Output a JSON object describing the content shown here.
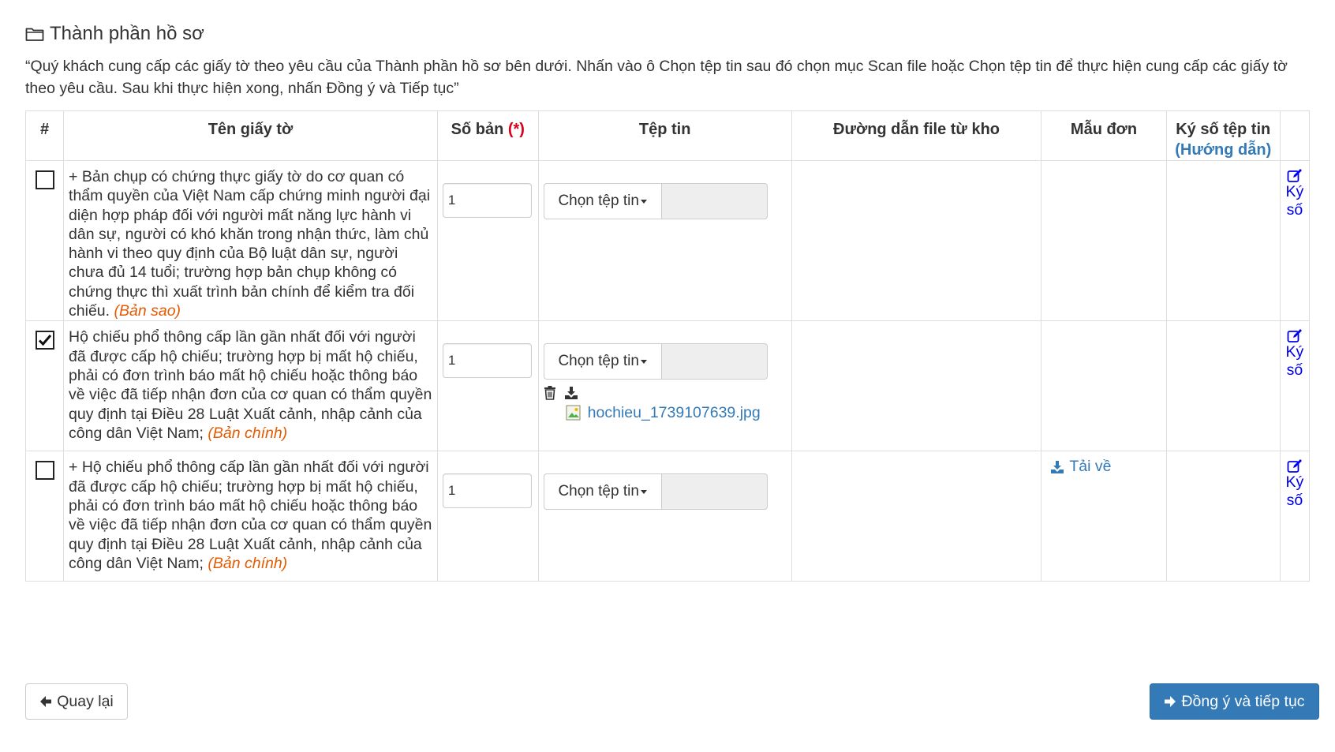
{
  "section": {
    "title": "Thành phần hồ sơ",
    "icon": "folder-open-icon",
    "instructions": "“Quý khách cung cấp các giấy tờ theo yêu cầu của Thành phần hồ sơ bên dưới. Nhấn vào ô Chọn tệp tin sau đó chọn mục Scan file hoặc Chọn tệp tin để thực hiện cung cấp các giấy tờ theo yêu cầu. Sau khi thực hiện xong, nhấn Đồng ý và Tiếp tục”"
  },
  "table": {
    "headers": {
      "index": "#",
      "name": "Tên giấy tờ",
      "copies": "Số bản",
      "copies_required": "(*)",
      "file": "Tệp tin",
      "repo_path": "Đường dẫn file từ kho",
      "template": "Mẫu đơn",
      "sign_file": "Ký số tệp tin",
      "sign_guide": "(Hướng dẫn)"
    },
    "choose_file_label": "Chọn tệp tin",
    "sign_label": "Ký số",
    "rows": [
      {
        "checked": false,
        "name": "+ Bản chụp có chứng thực giấy tờ do cơ quan có thẩm quyền của Việt Nam cấp chứng minh người đại diện hợp pháp đối với người mất năng lực hành vi dân sự, người có khó khăn trong nhận thức, làm chủ hành vi theo quy định của Bộ luật dân sự, người chưa đủ 14 tuổi; trường hợp bản chụp không có chứng thực thì xuất trình bản chính để kiểm tra đối chiếu.",
        "doc_type": "(Bản sao)",
        "copies": "1",
        "uploaded_file": "",
        "template_link": ""
      },
      {
        "checked": true,
        "name": "Hộ chiếu phổ thông cấp lần gần nhất đối với người đã được cấp hộ chiếu; trường hợp bị mất hộ chiếu, phải có đơn trình báo mất hộ chiếu hoặc thông báo về việc đã tiếp nhận đơn của cơ quan có thẩm quyền quy định tại Điều 28 Luật Xuất cảnh, nhập cảnh của công dân Việt Nam;",
        "doc_type": "(Bản chính)",
        "copies": "1",
        "uploaded_file": "hochieu_1739107639.jpg",
        "template_link": ""
      },
      {
        "checked": false,
        "name": "+ Hộ chiếu phổ thông cấp lần gần nhất đối với người đã được cấp hộ chiếu; trường hợp bị mất hộ chiếu, phải có đơn trình báo mất hộ chiếu hoặc thông báo về việc đã tiếp nhận đơn của cơ quan có thẩm quyền quy định tại Điều 28 Luật Xuất cảnh, nhập cảnh của công dân Việt Nam;",
        "doc_type": "(Bản chính)",
        "copies": "1",
        "uploaded_file": "",
        "template_link": "Tải về"
      }
    ]
  },
  "footer": {
    "back_label": "Quay lại",
    "next_label": "Đồng ý và tiếp tục"
  },
  "colors": {
    "link": "#337ab7",
    "primary": "#337ab7",
    "doc_type": "#e35a00",
    "required": "#d9001b",
    "sign_link": "#0000ee"
  }
}
